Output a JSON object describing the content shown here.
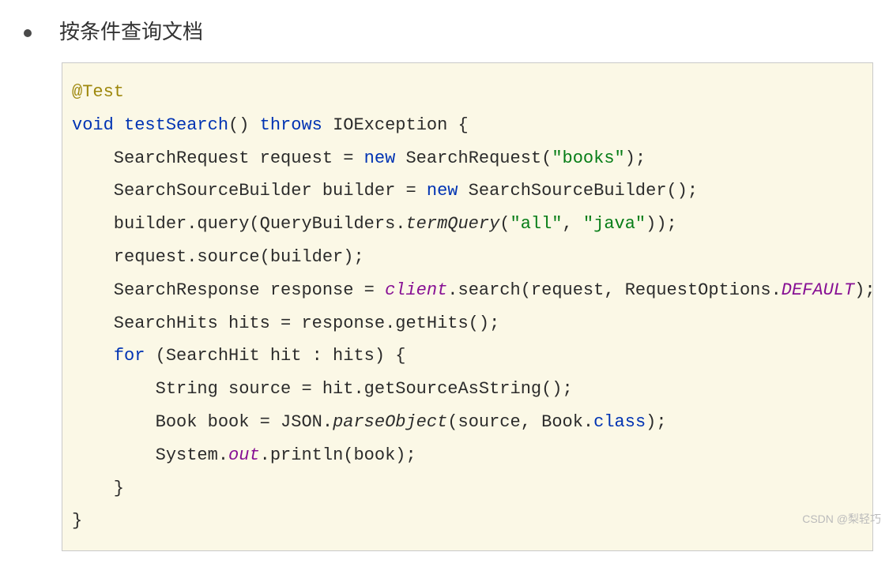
{
  "heading": "按条件查询文档",
  "code": {
    "annotation": "@Test",
    "kw_void": "void",
    "method_name": "testSearch",
    "kw_throws": "throws",
    "exception": "IOException",
    "line1_a": "    SearchRequest request = ",
    "kw_new1": "new",
    "line1_b": " SearchRequest(",
    "str_books": "\"books\"",
    "line1_c": ");",
    "line2_a": "    SearchSourceBuilder builder = ",
    "kw_new2": "new",
    "line2_b": " SearchSourceBuilder();",
    "line3_a": "    builder.query(QueryBuilders.",
    "termQuery": "termQuery",
    "line3_b": "(",
    "str_all": "\"all\"",
    "line3_c": ", ",
    "str_java": "\"java\"",
    "line3_d": "));",
    "line4": "    request.source(builder);",
    "line5_a": "    SearchResponse response = ",
    "client": "client",
    "line5_b": ".search(request, RequestOptions.",
    "default": "DEFAULT",
    "line5_c": ");",
    "line6": "    SearchHits hits = response.getHits();",
    "kw_for": "for",
    "line7_a": " (SearchHit hit : hits) {",
    "line8": "        String source = hit.getSourceAsString();",
    "line9_a": "        Book book = JSON.",
    "parseObject": "parseObject",
    "line9_b": "(source, Book.",
    "kw_class": "class",
    "line9_c": ");",
    "line10_a": "        System.",
    "out": "out",
    "line10_b": ".println(book);",
    "line11": "    }",
    "line12": "}"
  },
  "watermark": "CSDN @梨轻巧"
}
